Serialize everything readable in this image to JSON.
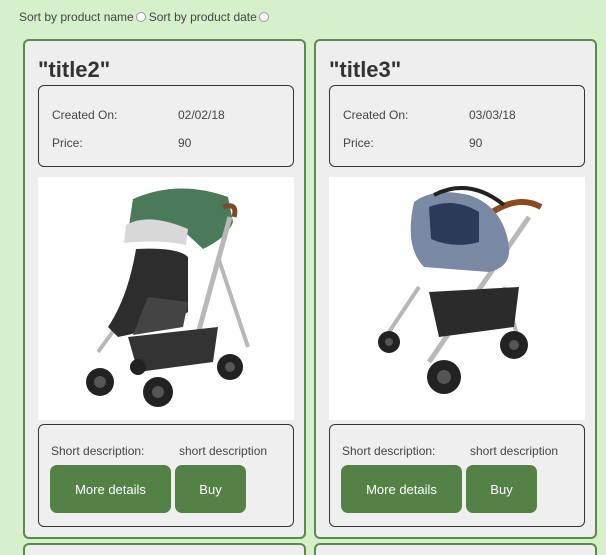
{
  "sort": {
    "by_name_label": "Sort by product name",
    "by_date_label": "Sort by product date"
  },
  "products": [
    {
      "title": "\"title2\"",
      "created_label": "Created On:",
      "created_value": "02/02/18",
      "price_label": "Price:",
      "price_value": "90",
      "short_desc_label": "Short description:",
      "short_desc_value": "short description",
      "more_label": "More details",
      "buy_label": "Buy",
      "image": "stroller-with-green-canopy"
    },
    {
      "title": "\"title3\"",
      "created_label": "Created On:",
      "created_value": "03/03/18",
      "price_label": "Price:",
      "price_value": "90",
      "short_desc_label": "Short description:",
      "short_desc_value": "short description",
      "more_label": "More details",
      "buy_label": "Buy",
      "image": "stroller-with-car-seat"
    }
  ],
  "colors": {
    "page_bg": "#d6f0cc",
    "card_border": "#5a8b4b",
    "button_bg": "#538146"
  }
}
